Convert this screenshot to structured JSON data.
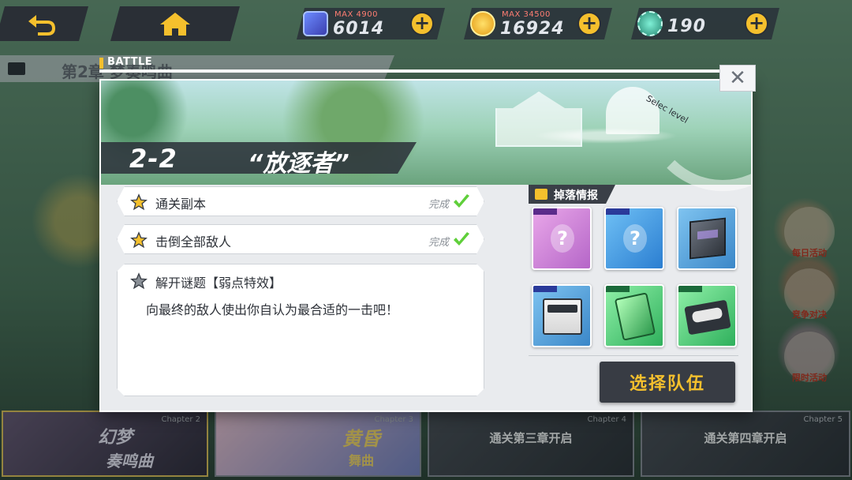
{
  "topbar": {
    "resources": [
      {
        "icon": "gem-icon",
        "max_label": "MAX 4900",
        "value": "6014"
      },
      {
        "icon": "gold-coin-icon",
        "max_label": "MAX 34500",
        "value": "16924"
      },
      {
        "icon": "gear-token-icon",
        "max_label": "",
        "value": "190"
      }
    ],
    "plus_symbol": "+"
  },
  "background": {
    "chapter_title": "第2章 梦奏鸣曲",
    "chapter_cards": [
      {
        "num": "Chapter 2",
        "title": "幻梦",
        "subtitle": "奏鸣曲"
      },
      {
        "num": "Chapter 3",
        "title": "黄昏",
        "subtitle": "舞曲"
      },
      {
        "num": "Chapter 4",
        "title": "通关第三章开启"
      },
      {
        "num": "Chapter 5",
        "title": "通关第四章开启"
      }
    ],
    "events": [
      "每日活动",
      "竞争对决",
      "限时活动"
    ]
  },
  "modal": {
    "section_label": "BATTLE",
    "close_symbol": "✕",
    "banner": {
      "select_level": "Selec level",
      "stage_id": "2-2",
      "stage_name": "“放逐者”"
    },
    "objectives": [
      {
        "label": "通关副本",
        "status": "完成",
        "star_color": "#f5c02d"
      },
      {
        "label": "击倒全部敌人",
        "status": "完成",
        "star_color": "#f5c02d"
      }
    ],
    "hint": {
      "title": "解开谜题【弱点特效】",
      "text": "向最终的敌人使出你自认为最合适的一击吧！",
      "star_color": "#8a9097"
    },
    "drops": {
      "title": "掉落情报",
      "items": [
        {
          "icon": "unknown-character-icon",
          "rarity": "purple",
          "mark": "?"
        },
        {
          "icon": "unknown-slime-icon",
          "rarity": "blue",
          "mark": "?"
        },
        {
          "icon": "cube-armor-icon",
          "rarity": "blue",
          "mark": ""
        },
        {
          "icon": "supply-box-icon",
          "rarity": "blue",
          "mark": ""
        },
        {
          "icon": "green-card-icon",
          "rarity": "green",
          "mark": ""
        },
        {
          "icon": "cassette-tape-icon",
          "rarity": "green",
          "mark": ""
        }
      ]
    },
    "select_team_label": "选择队伍"
  },
  "colors": {
    "accent": "#f5c02d",
    "dark": "#383c44",
    "check": "#5fcf3a"
  }
}
